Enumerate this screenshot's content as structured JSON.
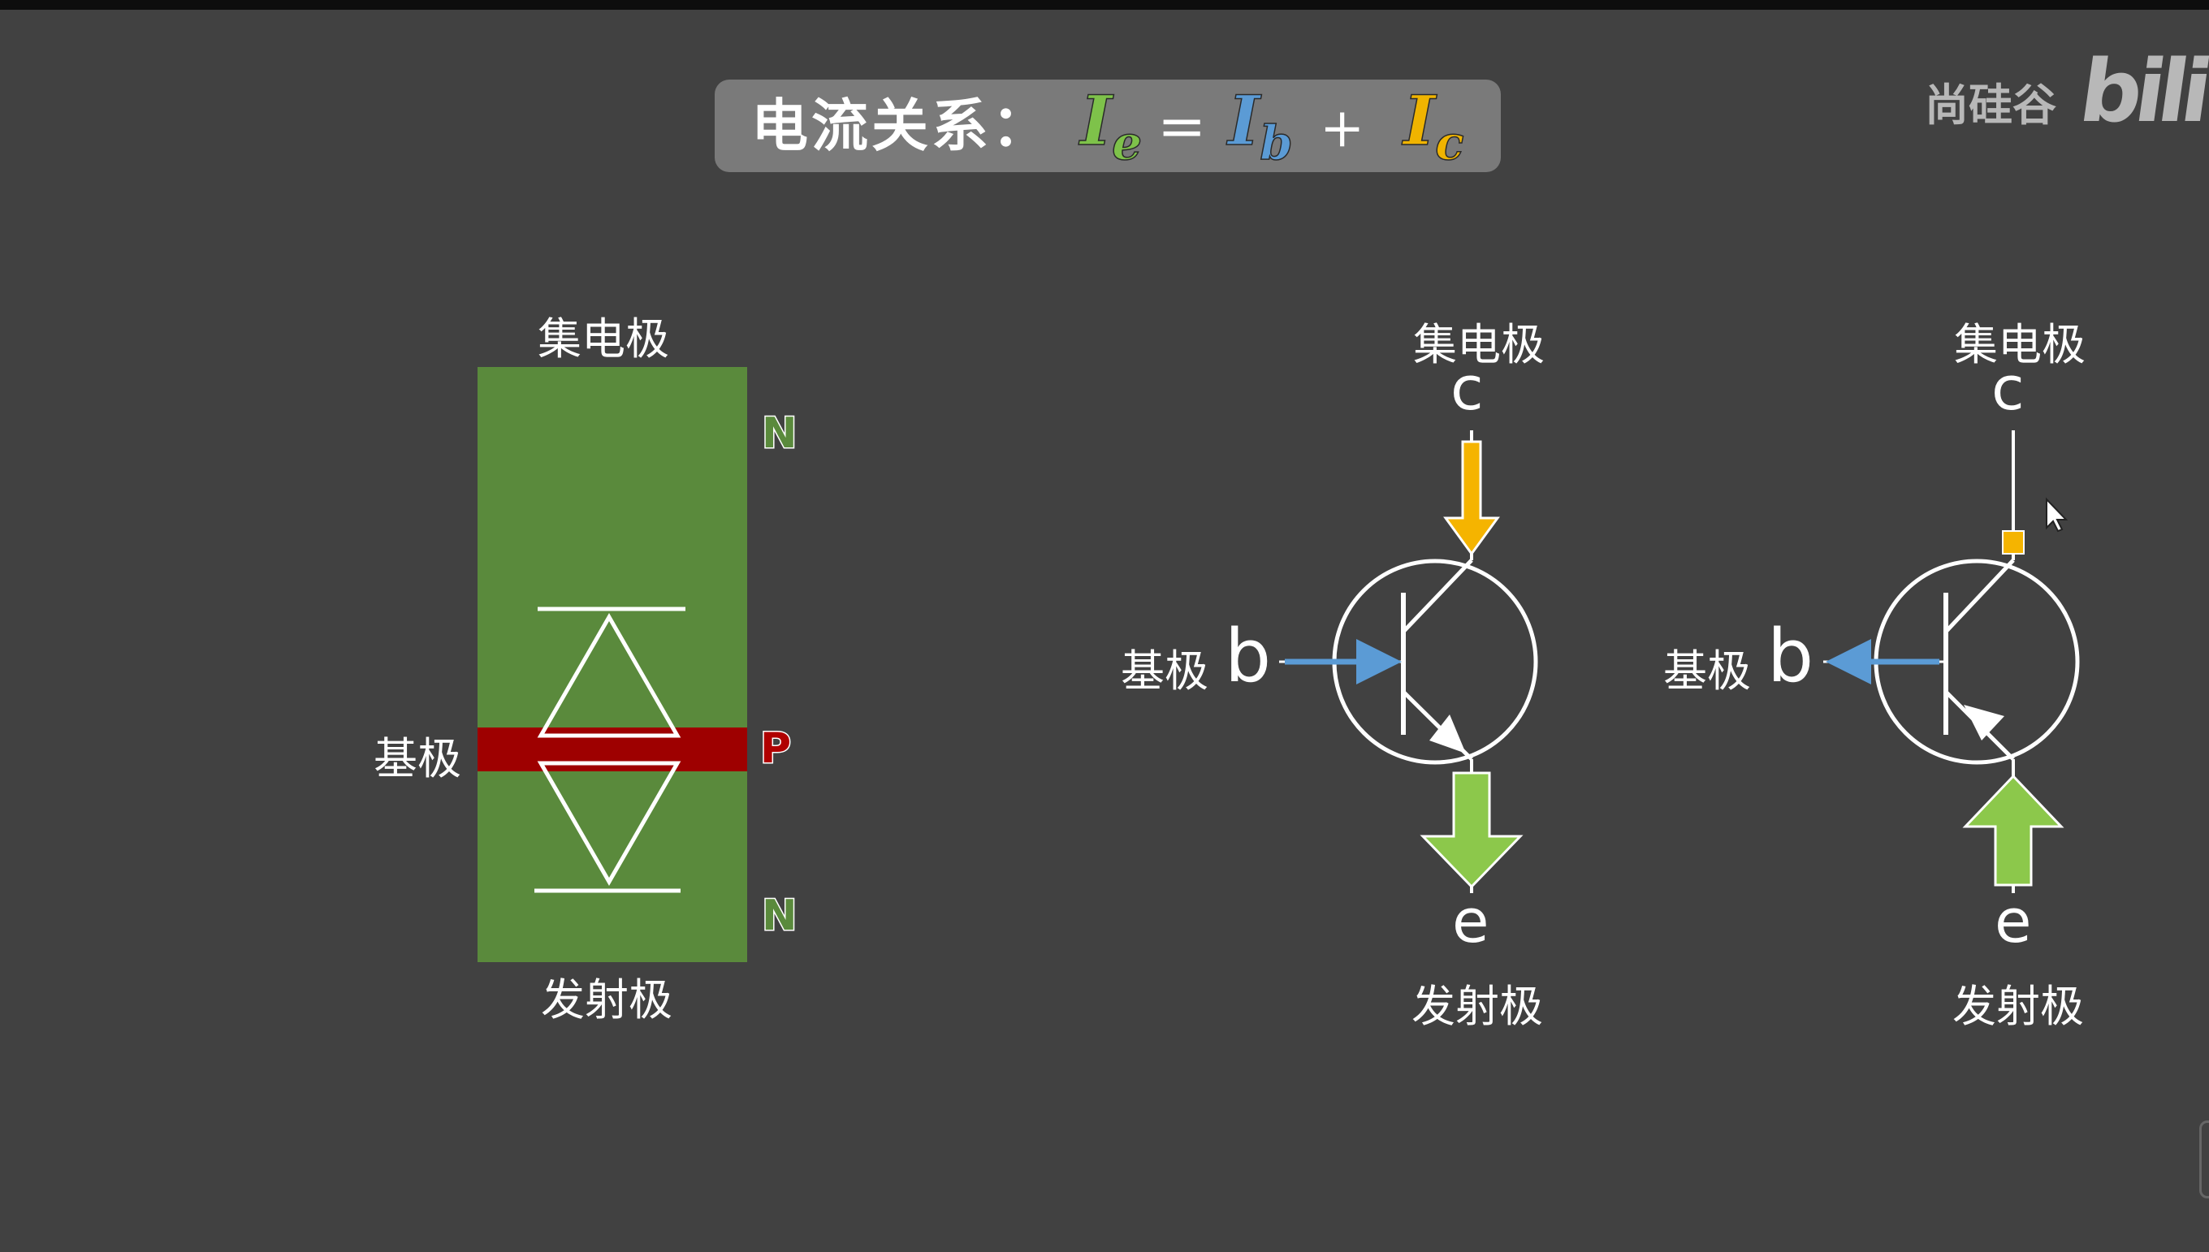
{
  "title": {
    "label": "电流关系：",
    "formula": {
      "Ie": {
        "base": "I",
        "sub": "e"
      },
      "equals": "=",
      "Ib": {
        "base": "I",
        "sub": "b"
      },
      "plus": "+",
      "Ic": {
        "base": "I",
        "sub": "c"
      }
    }
  },
  "colors": {
    "background": "#414141",
    "n_region": "#5a8a3c",
    "p_region": "#9e0000",
    "current_ie": "#7ec24a",
    "current_ib": "#5b9bd5",
    "current_ic": "#f0b400",
    "arrow_green": "#8cc84b",
    "arrow_orange": "#f5b400",
    "arrow_blue": "#5b9bd5"
  },
  "watermark": {
    "text": "尚硅谷",
    "logo": "bilib",
    "logo_icon": "bilibili-logo-icon"
  },
  "semiconductor": {
    "collector_label": "集电极",
    "base_label": "基极",
    "emitter_label": "发射极",
    "top_layer": "N",
    "middle_layer": "P",
    "bottom_layer": "N"
  },
  "transistor_npn": {
    "collector_label": "集电极",
    "collector_pin": "c",
    "base_label": "基极",
    "base_pin": "b",
    "emitter_pin": "e",
    "emitter_label": "发射极"
  },
  "transistor_pnp": {
    "collector_label": "集电极",
    "collector_pin": "c",
    "base_label": "基极",
    "base_pin": "b",
    "emitter_pin": "e",
    "emitter_label": "发射极"
  }
}
